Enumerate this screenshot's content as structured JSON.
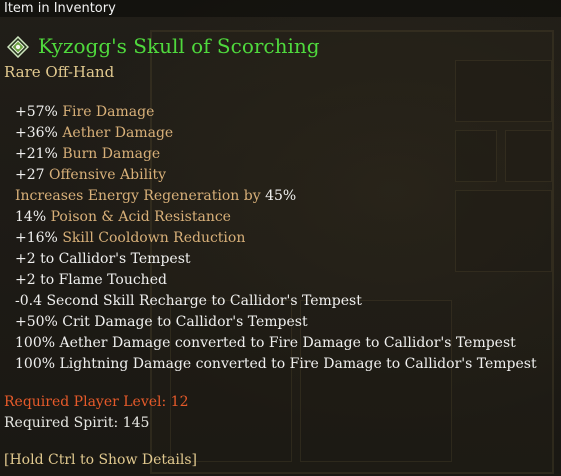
{
  "header": {
    "label": "Item in Inventory"
  },
  "item": {
    "icon": "rare-item-emblem-icon",
    "name": "Kyzogg's Skull of Scorching",
    "type": "Rare Off-Hand",
    "name_color": "#4fd93d",
    "type_color": "#e1c98f"
  },
  "stats": [
    {
      "value": "+57%",
      "label": "Fire Damage"
    },
    {
      "value": "+36%",
      "label": "Aether Damage"
    },
    {
      "value": "+21%",
      "label": "Burn Damage"
    },
    {
      "value": "+27",
      "label": "Offensive Ability"
    },
    {
      "prefix": "Increases Energy Regeneration by",
      "value": "45%"
    },
    {
      "value": "14%",
      "label": "Poison & Acid Resistance"
    },
    {
      "value": "+16%",
      "label": "Skill Cooldown Reduction"
    },
    {
      "text": "+2 to Callidor's Tempest"
    },
    {
      "text": "+2 to Flame Touched"
    },
    {
      "text": "-0.4 Second Skill Recharge to Callidor's Tempest"
    },
    {
      "text": "+50% Crit Damage to Callidor's Tempest"
    },
    {
      "text": "100% Aether Damage converted to Fire Damage to Callidor's Tempest"
    },
    {
      "text": "100% Lightning Damage converted to Fire Damage to Callidor's Tempest"
    }
  ],
  "requirements": {
    "level": "Required Player Level: 12",
    "spirit": "Required Spirit: 145",
    "level_color": "#e65a2a"
  },
  "footer": {
    "hint": "[Hold Ctrl to Show Details]"
  }
}
